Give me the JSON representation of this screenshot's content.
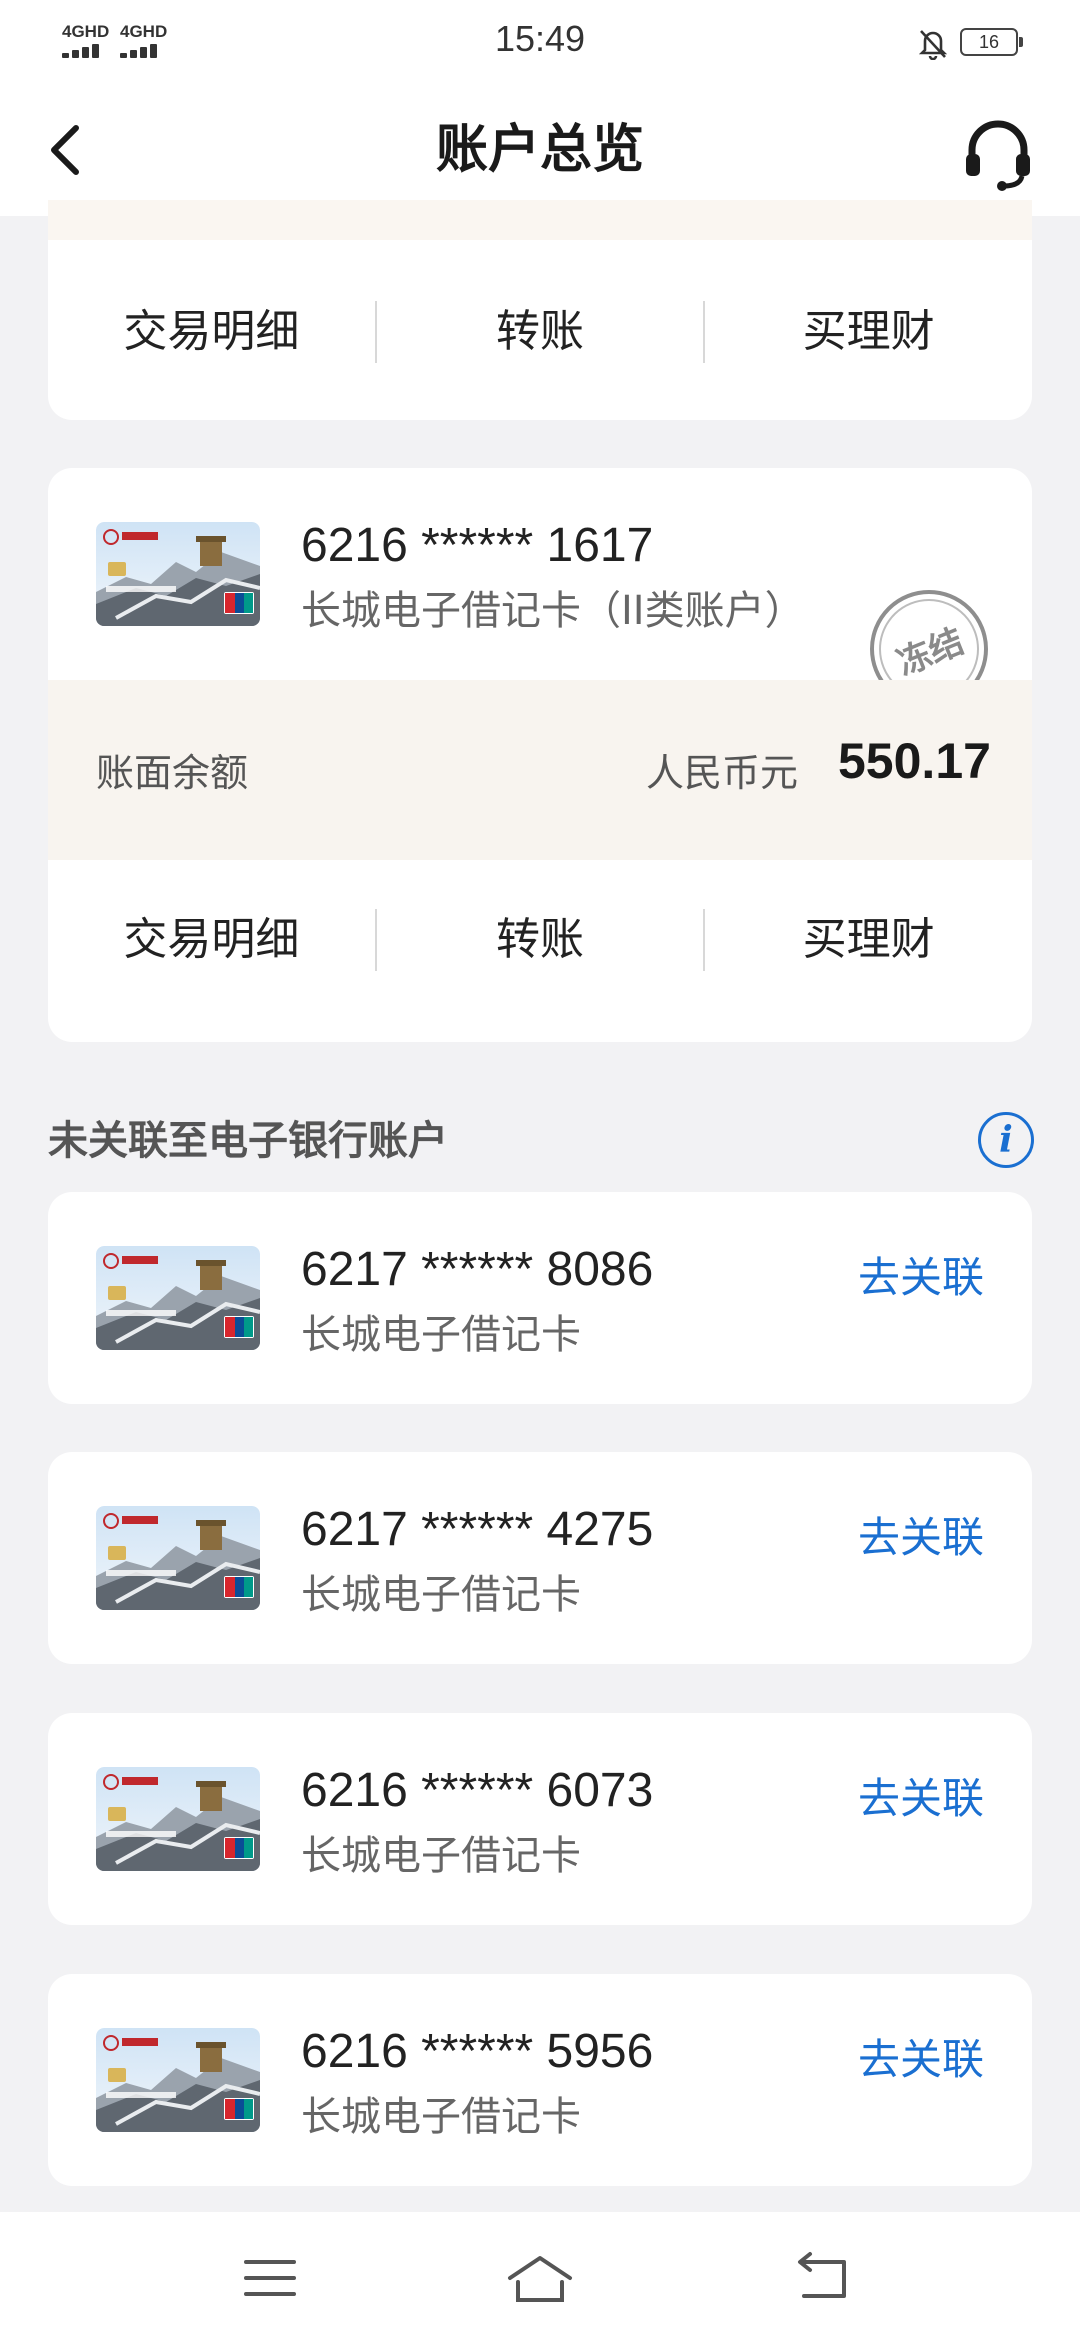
{
  "status_bar": {
    "time": "15:49",
    "sim1": "4GHD",
    "sim2": "4GHD",
    "battery": "16",
    "icons": [
      "signal-icon",
      "bell-off-icon",
      "battery-icon"
    ]
  },
  "header": {
    "title": "账户总览",
    "back_icon": "chevron-left-icon",
    "support_icon": "headset-icon"
  },
  "card_top_partial": {
    "actions": [
      "交易明细",
      "转账",
      "买理财"
    ]
  },
  "account_card": {
    "number": "6216 ****** 1617",
    "type": "长城电子借记卡（II类账户）",
    "stamp": "冻结",
    "balance_label": "账面余额",
    "currency": "人民币元",
    "balance": "550.17",
    "actions": [
      "交易明细",
      "转账",
      "买理财"
    ]
  },
  "unlinked_section": {
    "title": "未关联至电子银行账户",
    "info_icon": "info-icon",
    "link_label": "去关联",
    "cards": [
      {
        "number": "6217 ****** 8086",
        "type": "长城电子借记卡"
      },
      {
        "number": "6217 ****** 4275",
        "type": "长城电子借记卡"
      },
      {
        "number": "6216 ****** 6073",
        "type": "长城电子借记卡"
      },
      {
        "number": "6216 ****** 5956",
        "type": "长城电子借记卡"
      }
    ]
  },
  "colors": {
    "accent": "#1a6fd1",
    "page_bg": "#f2f2f4",
    "balance_band": "#f8f4ef"
  }
}
